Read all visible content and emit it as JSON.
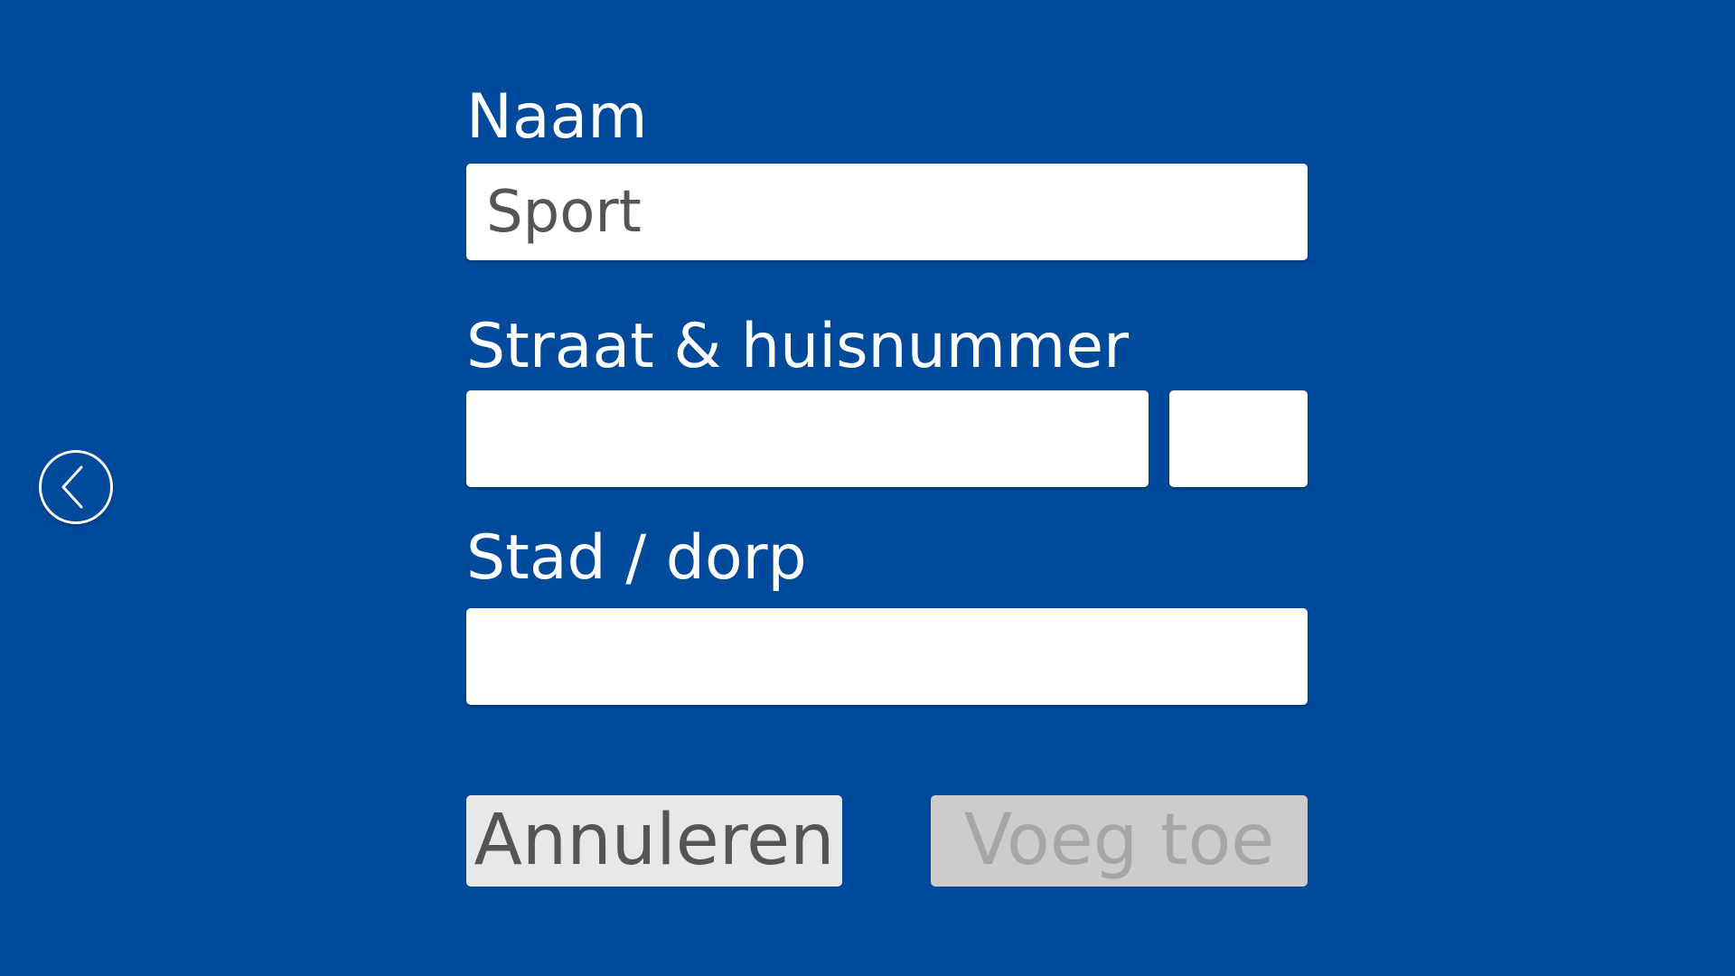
{
  "navigation": {
    "back_icon": "chevron-left-circle-icon"
  },
  "form": {
    "name": {
      "label": "Naam",
      "value": "Sport"
    },
    "street": {
      "label": "Straat & huisnummer",
      "street_value": "",
      "number_value": ""
    },
    "city": {
      "label": "Stad / dorp",
      "value": ""
    }
  },
  "actions": {
    "cancel_label": "Annuleren",
    "add_label": "Voeg toe",
    "add_enabled": false
  },
  "colors": {
    "background": "#004a9c",
    "field": "#ffffff",
    "cancel_button": "#e8e8e8",
    "add_button_disabled": "#cccccc"
  }
}
